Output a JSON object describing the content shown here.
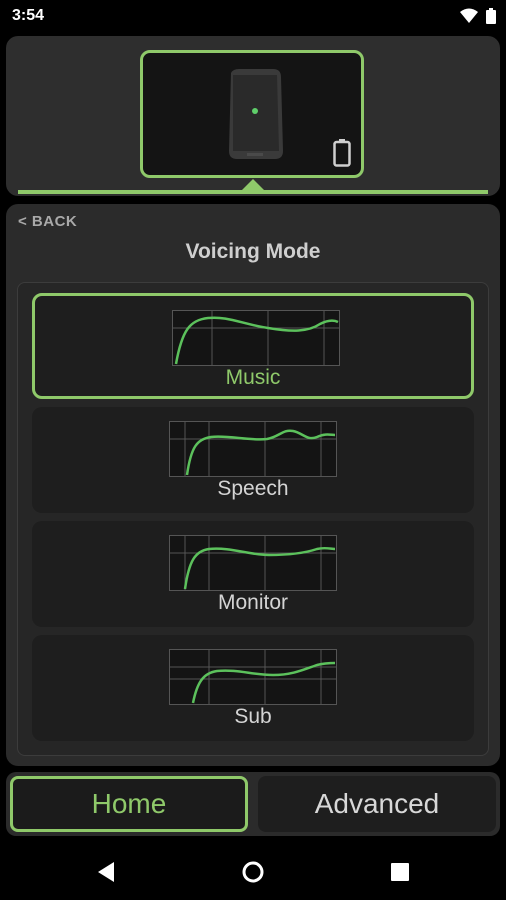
{
  "status_bar": {
    "time": "3:54"
  },
  "device": {
    "name_icon": "speaker-icon",
    "battery_icon": "battery-icon"
  },
  "nav": {
    "back_label": "< BACK"
  },
  "page": {
    "title": "Voicing Mode"
  },
  "modes": [
    {
      "label": "Music",
      "selected": true,
      "icon": "eq-curve-icon"
    },
    {
      "label": "Speech",
      "selected": false,
      "icon": "eq-curve-icon"
    },
    {
      "label": "Monitor",
      "selected": false,
      "icon": "eq-curve-icon"
    },
    {
      "label": "Sub",
      "selected": false,
      "icon": "eq-curve-icon"
    }
  ],
  "tabs": [
    {
      "label": "Home",
      "active": true
    },
    {
      "label": "Advanced",
      "active": false
    }
  ],
  "colors": {
    "accent": "#8fc96a",
    "panel": "#2b2b2b",
    "card": "#1e1e1e"
  }
}
